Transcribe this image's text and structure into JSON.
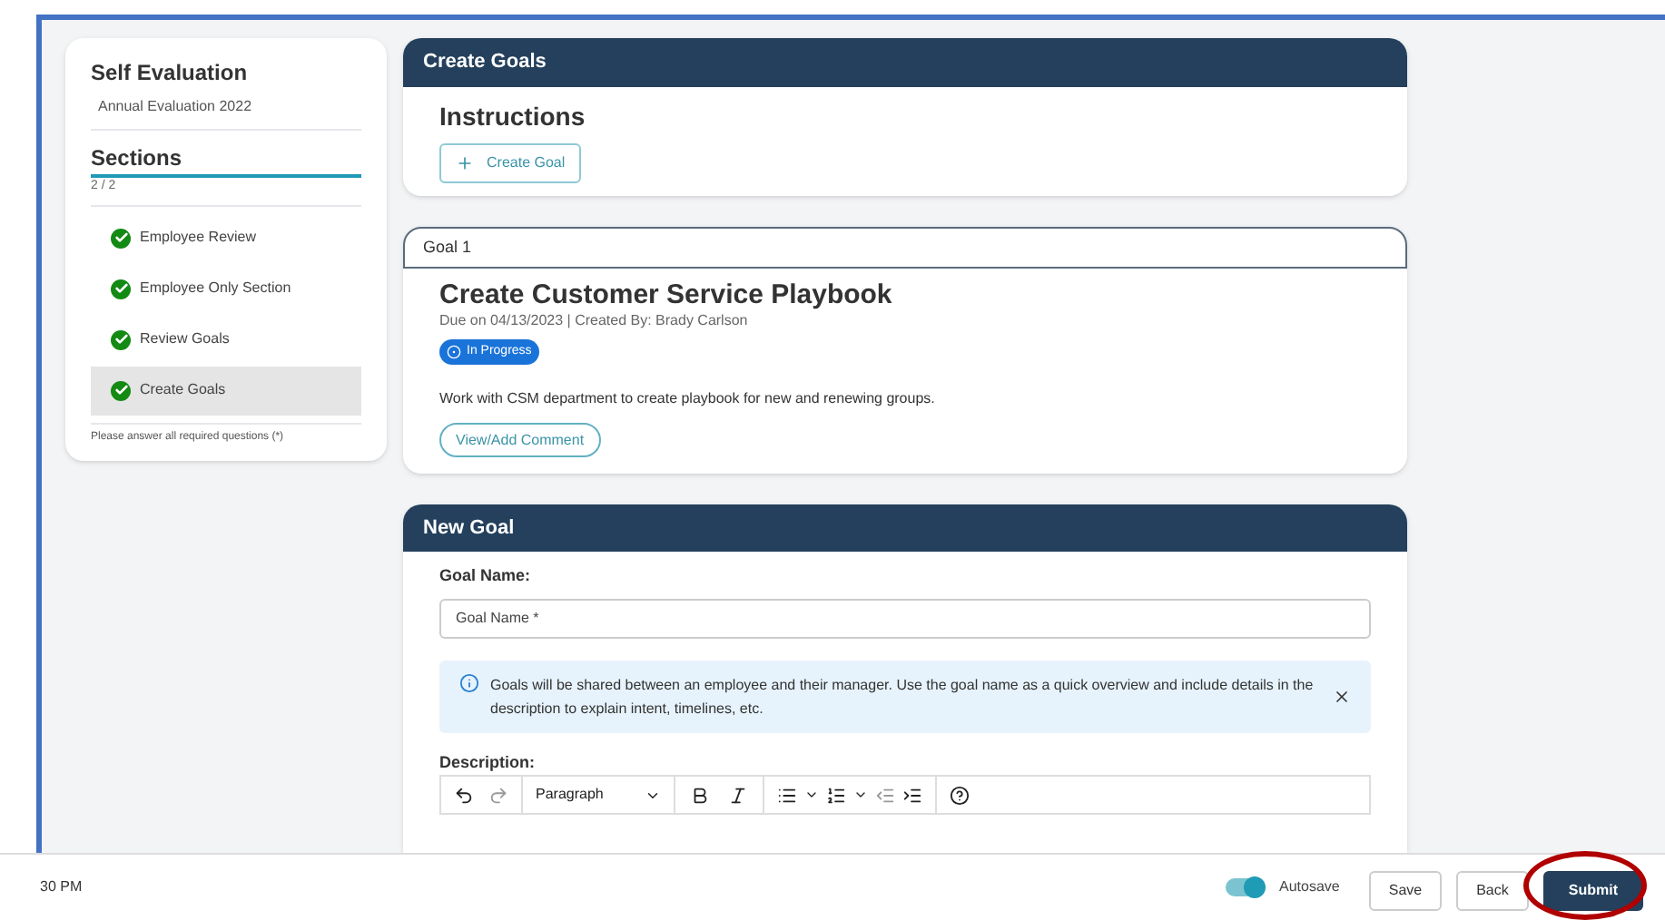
{
  "sidebar": {
    "title": "Self Evaluation",
    "subtitle": "Annual Evaluation 2022",
    "sections_heading": "Sections",
    "progress": "2 / 2",
    "level": 1,
    "items": [
      {
        "label": "Employee Review",
        "completed": true,
        "selected": false
      },
      {
        "label": "Employee Only Section",
        "completed": true,
        "selected": false
      },
      {
        "label": "Review Goals",
        "completed": true,
        "selected": false
      },
      {
        "label": "Create Goals",
        "completed": true,
        "selected": true
      }
    ],
    "note": "Please answer all required questions (*)"
  },
  "create_goals": {
    "header": "Create Goals",
    "heading": "Instructions",
    "button": "Create Goal"
  },
  "goal": {
    "header": "Goal 1",
    "title": "Create Customer Service Playbook",
    "meta": "Due on 04/13/2023 | Created By: Brady Carlson",
    "status": "In Progress",
    "description": "Work with CSM department to create playbook for new and renewing groups.",
    "button": "View/Add Comment"
  },
  "new_goal": {
    "header": "New Goal",
    "name_label": "Goal Name:",
    "name_placeholder": "Goal Name *",
    "info": "Goals will be shared between an employee and their manager. Use the goal name as a quick overview and include details in the description to explain intent, timelines, etc.",
    "description_label": "Description:",
    "block_format": "Paragraph"
  },
  "footer": {
    "time": "30 PM",
    "autosave": {
      "label": "Autosave",
      "on": true
    },
    "buttons": [
      {
        "label": "Save",
        "kind": "outline"
      },
      {
        "label": "Back",
        "kind": "outline"
      },
      {
        "label": "Submit",
        "kind": "primary",
        "highlighted": true
      }
    ]
  }
}
